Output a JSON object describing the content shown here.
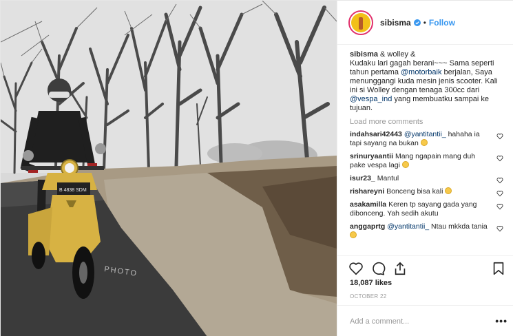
{
  "header": {
    "username": "sibisma",
    "separator": "•",
    "follow_label": "Follow",
    "verified_icon": "verified-badge-icon"
  },
  "caption": {
    "username": "sibisma",
    "line1": "& wolley &",
    "part1": "Kudaku lari gagah berani~~~ Sama seperti tahun pertama ",
    "mention1": "@motorbaik",
    "part2": " berjalan, Saya menunggangi kuda mesin jenis scooter. Kali ini si Wolley dengan tenaga 300cc dari ",
    "mention2": "@vespa_ind",
    "part3": " yang membuatku sampai ke tujuan."
  },
  "load_more_label": "Load more comments",
  "comments": [
    {
      "user": "indahsari42443",
      "mention": "@yantitantii_",
      "text": " hahaha ia tapi sayang na bukan",
      "emoji": "grin-emoji"
    },
    {
      "user": "srinuryaantii",
      "mention": "",
      "text": "Mang ngapain mang duh pake vespa lagi",
      "emoji": "grin-emoji"
    },
    {
      "user": "isur23_",
      "mention": "",
      "text": "Mantul",
      "emoji": ""
    },
    {
      "user": "rishareyni",
      "mention": "",
      "text": "Bonceng bisa kali",
      "emoji": "laugh-emoji"
    },
    {
      "user": "asakamilla",
      "mention": "",
      "text": "Keren tp sayang gada yang dibonceng. Yah sedih akutu",
      "emoji": ""
    },
    {
      "user": "anggaprtg",
      "mention": "@yantitantii_",
      "text": " Ntau mkkda tania",
      "emoji": "laugh-emoji"
    }
  ],
  "actions": {
    "like_icon": "heart-icon",
    "comment_icon": "comment-icon",
    "share_icon": "share-icon",
    "save_icon": "bookmark-icon"
  },
  "likes": "18,087 likes",
  "date": "OCTOBER 22",
  "add_comment": {
    "placeholder": "Add a comment...",
    "more_label": "•••"
  },
  "photo": {
    "plate_text": "B 4838 SDM"
  },
  "colors": {
    "accent": "#3897f0",
    "scooter": "#d7b243",
    "text": "#262626",
    "muted": "#999999"
  }
}
